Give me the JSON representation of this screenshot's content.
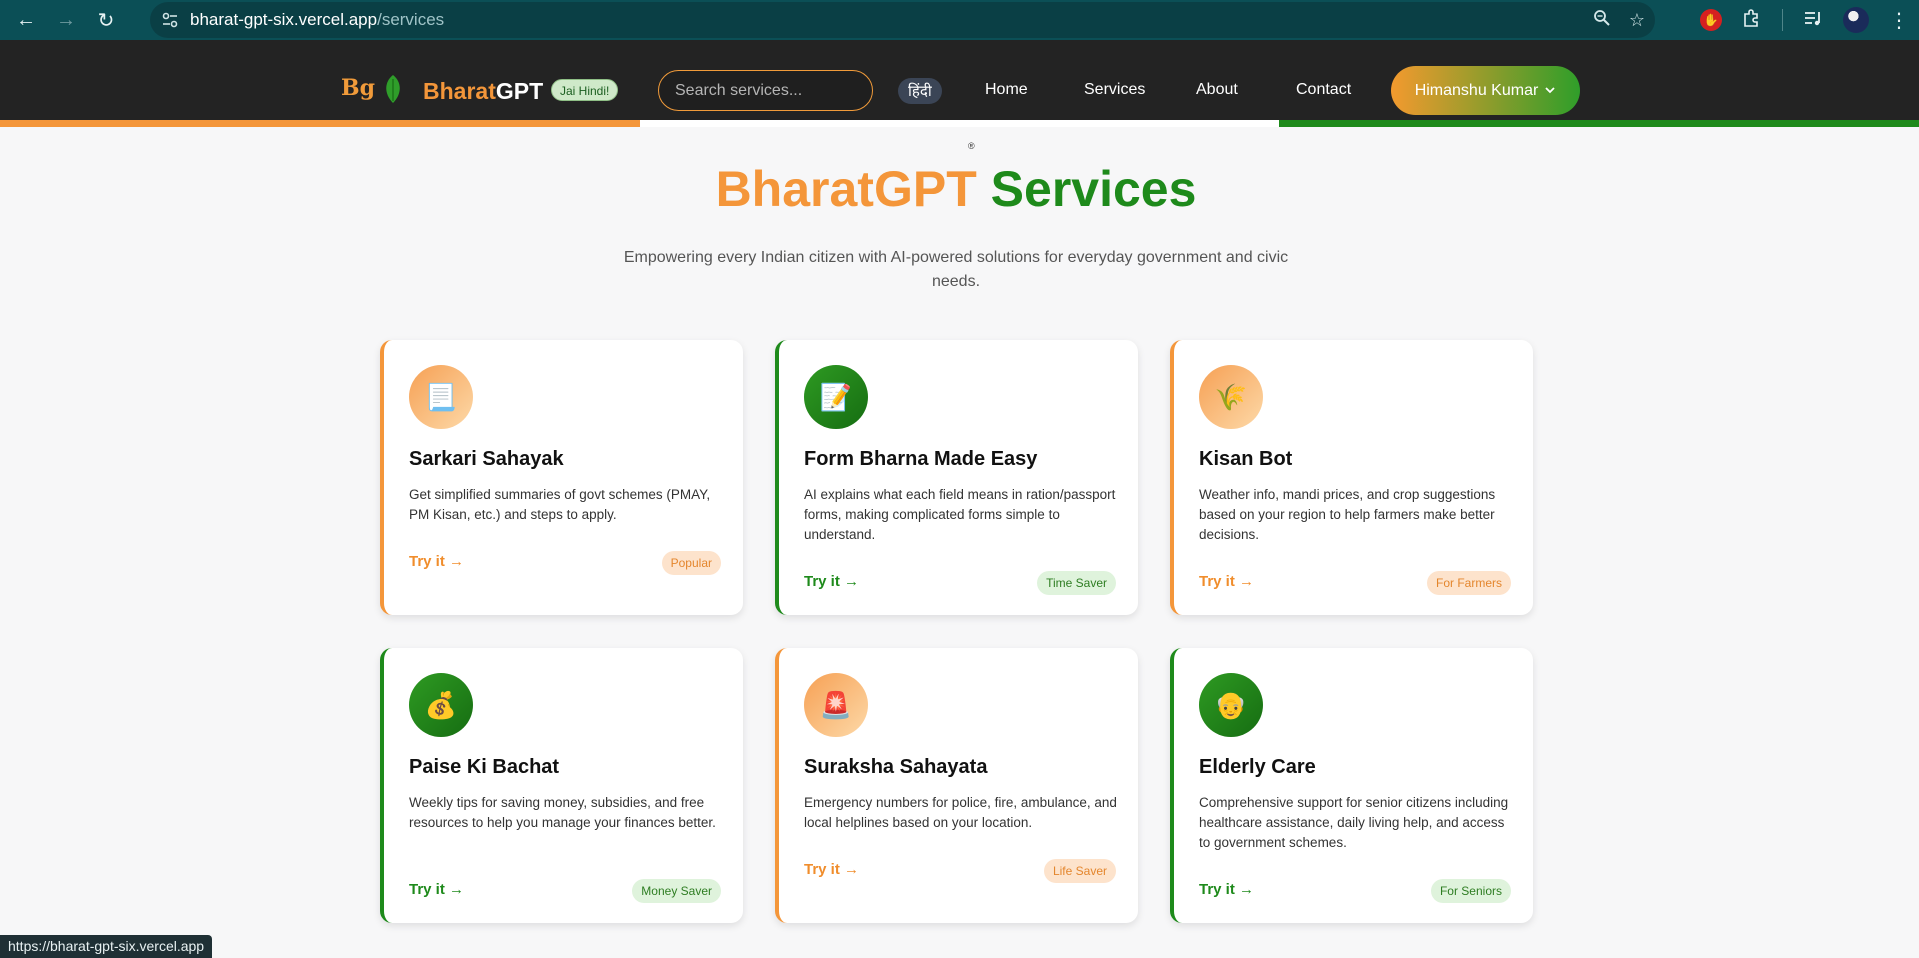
{
  "browser": {
    "url_host": "bharat-gpt-six.vercel.app",
    "url_path": "/services",
    "status_url": "https://bharat-gpt-six.vercel.app"
  },
  "header": {
    "logo_text": "Bg",
    "brand_part1": "Bharat",
    "brand_part2": "GPT",
    "tagline_badge": "Jai Hindi!",
    "search_placeholder": "Search services...",
    "language_toggle": "हिंदी",
    "nav": [
      "Home",
      "Services",
      "About",
      "Contact"
    ],
    "user_name": "Himanshu Kumar",
    "tricolor": [
      "#f4963a",
      "#ffffff",
      "#1e8a1b"
    ]
  },
  "hero": {
    "registered_mark": "®",
    "title_part1": "BharatGPT",
    "title_part2": "Services",
    "subtitle": "Empowering every Indian citizen with AI-powered solutions for everyday government and civic needs."
  },
  "cards": [
    {
      "title": "Sarkari Sahayak",
      "description": "Get simplified summaries of govt schemes (PMAY, PM Kisan, etc.) and steps to apply.",
      "cta": "Try it →",
      "badge": "Popular",
      "icon": "document-icon",
      "emoji": "📃",
      "theme": "saffron"
    },
    {
      "title": "Form Bharna Made Easy",
      "description": "AI explains what each field means in ration/passport forms, making complicated forms simple to understand.",
      "cta": "Try it →",
      "badge": "Time Saver",
      "icon": "form-pencil-icon",
      "emoji": "📝",
      "theme": "green"
    },
    {
      "title": "Kisan Bot",
      "description": "Weather info, mandi prices, and crop suggestions based on your region to help farmers make better decisions.",
      "cta": "Try it →",
      "badge": "For Farmers",
      "icon": "crop-icon",
      "emoji": "🌾",
      "theme": "saffron"
    },
    {
      "title": "Paise Ki Bachat",
      "description": "Weekly tips for saving money, subsidies, and free resources to help you manage your finances better.",
      "cta": "Try it →",
      "badge": "Money Saver",
      "icon": "money-bag-icon",
      "emoji": "💰",
      "theme": "green"
    },
    {
      "title": "Suraksha Sahayata",
      "description": "Emergency numbers for police, fire, ambulance, and local helplines based on your location.",
      "cta": "Try it →",
      "badge": "Life Saver",
      "icon": "siren-icon",
      "emoji": "🚨",
      "theme": "saffron"
    },
    {
      "title": "Elderly Care",
      "description": "Comprehensive support for senior citizens including healthcare assistance, daily living help, and access to government schemes.",
      "cta": "Try it →",
      "badge": "For Seniors",
      "icon": "elderly-person-icon",
      "emoji": "👴",
      "theme": "green"
    }
  ]
}
